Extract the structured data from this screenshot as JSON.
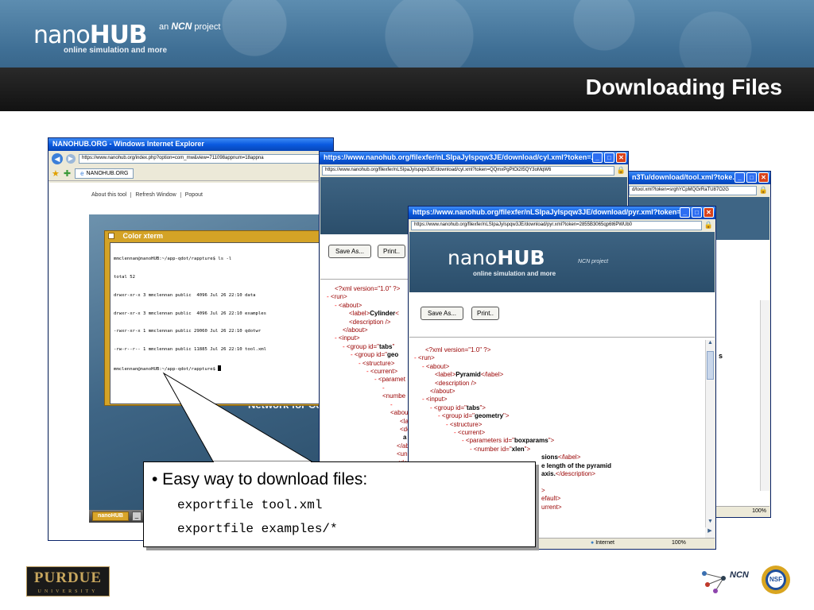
{
  "header": {
    "logo_main": "nano",
    "logo_hub": "HUB",
    "logo_tagline": "online simulation and more",
    "ncn_prefix": "an",
    "ncn_name": "NCN",
    "ncn_suffix": "project",
    "slide_title": "Downloading Files"
  },
  "ie_window": {
    "title": "NANOHUB.ORG - Windows Internet Explorer",
    "address": "https://www.nanohub.org/index.php?option=com_mw&view=711098appnum=18appna",
    "tab": "NANOHUB.ORG",
    "toolbar_links": [
      "About this tool",
      "Refresh Window",
      "Popout"
    ],
    "taskbar_label": "nanoHUB",
    "network_text": "Network for Co"
  },
  "xterm": {
    "title": "Color xterm",
    "lines": [
      "mmclennan@nanoHUB:~/app-qdot/rappture$ ls -l",
      "total 52",
      "drwxr-xr-x 3 mmclennan public  4096 Jul 26 22:10 data",
      "drwxr-xr-x 3 mmclennan public  4096 Jul 26 22:10 examples",
      "-rwxr-xr-x 1 mmclennan public 29060 Jul 26 22:10 qdotwr",
      "-rw-r--r-- 1 mmclennan public 11885 Jul 26 22:10 tool.xml",
      "mmclennan@nanoHUB:~/app-qdot/rappture$ "
    ]
  },
  "cyl_window": {
    "title": "https://www.nanohub.org/filexfer/nLSIpaJyIspqw3JE/download/cyl.xml?token=...",
    "address": "https://www.nanohub.org/filexfer/nLSIpaJyIspqw3JE/download/cyl.xml?token=QQmxPgPtOi2I5QY3oMqW6",
    "save_label": "Save As...",
    "print_label": "Print.."
  },
  "tool_window": {
    "title": "n3Tu/download/tool.xml?toke...",
    "address": "d/tool.xml?token=srghYCpMQGrRaTU87O2G",
    "status_zoom": "100%",
    "side_text": "s"
  },
  "pyr_window": {
    "title": "https://www.nanohub.org/filexfer/nLSIpaJyIspqw3JE/download/pyr.xml?token=...",
    "address": "https://www.nanohub.org/filexfer/nLSIpaJyIspqw3JE/download/pyr.xml?token=2855B3065qp6t6PWUb0",
    "logo_main": "nano",
    "logo_hub": "HUB",
    "logo_tagline": "online simulation and more",
    "logo_ncn": "NCN project",
    "save_label": "Save As...",
    "print_label": "Print..",
    "status_zone": "Internet",
    "status_zoom": "100%"
  },
  "callout": {
    "bullet": "• Easy way to download files:",
    "cmd1": "exportfile tool.xml",
    "cmd2": "exportfile examples/*"
  },
  "footer": {
    "purdue_name": "PURDUE",
    "purdue_univ": "UNIVERSITY",
    "ncn_label": "NCN",
    "nsf_label": "NSF"
  }
}
